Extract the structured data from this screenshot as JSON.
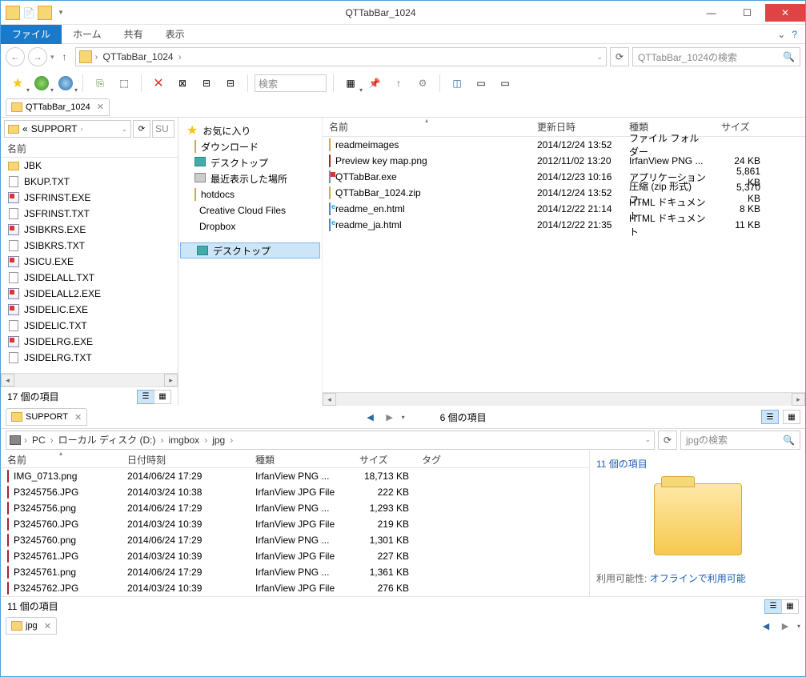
{
  "window": {
    "title": "QTTabBar_1024"
  },
  "ribbon": {
    "file": "ファイル",
    "tabs": [
      "ホーム",
      "共有",
      "表示"
    ]
  },
  "address": {
    "folder": "QTTabBar_1024",
    "search_placeholder": "QTTabBar_1024の検索"
  },
  "toolbar": {
    "search_placeholder": "検索"
  },
  "tab1": {
    "label": "QTTabBar_1024"
  },
  "left": {
    "crumb_prefix": "«",
    "crumb": "SUPPORT",
    "search_short": "SU",
    "header_name": "名前",
    "files": [
      {
        "icon": "fold",
        "name": "JBK"
      },
      {
        "icon": "txt",
        "name": "BKUP.TXT"
      },
      {
        "icon": "exe",
        "name": "JSFRINST.EXE"
      },
      {
        "icon": "txt",
        "name": "JSFRINST.TXT"
      },
      {
        "icon": "exe",
        "name": "JSIBKRS.EXE"
      },
      {
        "icon": "txt",
        "name": "JSIBKRS.TXT"
      },
      {
        "icon": "exe",
        "name": "JSICU.EXE"
      },
      {
        "icon": "txt",
        "name": "JSIDELALL.TXT"
      },
      {
        "icon": "exe",
        "name": "JSIDELALL2.EXE"
      },
      {
        "icon": "exe",
        "name": "JSIDELIC.EXE"
      },
      {
        "icon": "txt",
        "name": "JSIDELIC.TXT"
      },
      {
        "icon": "exe",
        "name": "JSIDELRG.EXE"
      },
      {
        "icon": "txt",
        "name": "JSIDELRG.TXT"
      }
    ],
    "status": "17 個の項目"
  },
  "fav": {
    "header": "お気に入り",
    "items": [
      {
        "icon": "fold",
        "label": "ダウンロード"
      },
      {
        "icon": "desk",
        "label": "デスクトップ"
      },
      {
        "icon": "recent",
        "label": "最近表示した場所"
      },
      {
        "icon": "fold",
        "label": "hotdocs"
      },
      {
        "icon": "cc",
        "label": "Creative Cloud Files"
      },
      {
        "icon": "db",
        "label": "Dropbox"
      }
    ],
    "desktop": "デスクトップ"
  },
  "mainfiles": {
    "headers": {
      "name": "名前",
      "date": "更新日時",
      "type": "種類",
      "size": "サイズ"
    },
    "rows": [
      {
        "icon": "fold",
        "name": "readmeimages",
        "date": "2014/12/24 13:52",
        "type": "ファイル フォルダー",
        "size": ""
      },
      {
        "icon": "img",
        "name": "Preview key map.png",
        "date": "2012/11/02 13:20",
        "type": "IrfanView PNG ...",
        "size": "24 KB"
      },
      {
        "icon": "exe",
        "name": "QTTabBar.exe",
        "date": "2014/12/23 10:16",
        "type": "アプリケーション",
        "size": "5,861 KB"
      },
      {
        "icon": "zip",
        "name": "QTTabBar_1024.zip",
        "date": "2014/12/24 13:52",
        "type": "圧縮 (zip 形式) フ...",
        "size": "5,370 KB"
      },
      {
        "icon": "html",
        "name": "readme_en.html",
        "date": "2014/12/22 21:14",
        "type": "HTML ドキュメント",
        "size": "8 KB"
      },
      {
        "icon": "html",
        "name": "readme_ja.html",
        "date": "2014/12/22 21:35",
        "type": "HTML ドキュメント",
        "size": "11 KB"
      }
    ]
  },
  "pane2": {
    "tab_label": "SUPPORT",
    "item_count": "6 個の項目"
  },
  "bot": {
    "crumbs": [
      "PC",
      "ローカル ディスク (D:)",
      "imgbox",
      "jpg"
    ],
    "search_placeholder": "jpgの検索",
    "headers": {
      "name": "名前",
      "date": "日付時刻",
      "type": "種類",
      "size": "サイズ",
      "tag": "タグ"
    },
    "rows": [
      {
        "name": "IMG_0713.png",
        "date": "2014/06/24 17:29",
        "type": "IrfanView PNG ...",
        "size": "18,713 KB"
      },
      {
        "name": "P3245756.JPG",
        "date": "2014/03/24 10:38",
        "type": "IrfanView JPG File",
        "size": "222 KB"
      },
      {
        "name": "P3245756.png",
        "date": "2014/06/24 17:29",
        "type": "IrfanView PNG ...",
        "size": "1,293 KB"
      },
      {
        "name": "P3245760.JPG",
        "date": "2014/03/24 10:39",
        "type": "IrfanView JPG File",
        "size": "219 KB"
      },
      {
        "name": "P3245760.png",
        "date": "2014/06/24 17:29",
        "type": "IrfanView PNG ...",
        "size": "1,301 KB"
      },
      {
        "name": "P3245761.JPG",
        "date": "2014/03/24 10:39",
        "type": "IrfanView JPG File",
        "size": "227 KB"
      },
      {
        "name": "P3245761.png",
        "date": "2014/06/24 17:29",
        "type": "IrfanView PNG ...",
        "size": "1,361 KB"
      },
      {
        "name": "P3245762.JPG",
        "date": "2014/03/24 10:39",
        "type": "IrfanView JPG File",
        "size": "276 KB"
      }
    ],
    "status": "11 個の項目",
    "tab_label": "jpg"
  },
  "preview": {
    "title": "11 個の項目",
    "avail_label": "利用可能性:",
    "avail_value": "オフラインで利用可能"
  }
}
